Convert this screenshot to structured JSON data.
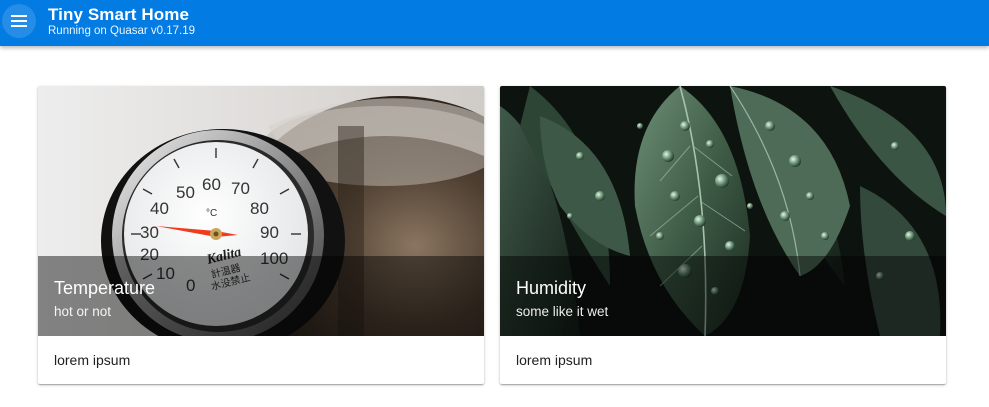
{
  "header": {
    "menu_icon": "menu-icon",
    "title": "Tiny Smart Home",
    "subtitle": "Running on Quasar v0.17.19",
    "color": "#027be3"
  },
  "cards": [
    {
      "title": "Temperature",
      "subtitle": "hot or not",
      "body": "lorem ipsum",
      "image": "thermometer-image",
      "image_text": [
        "Kalita",
        "計温器",
        "水没禁止"
      ]
    },
    {
      "title": "Humidity",
      "subtitle": "some like it wet",
      "body": "lorem ipsum",
      "image": "wet-leaves-image"
    }
  ]
}
